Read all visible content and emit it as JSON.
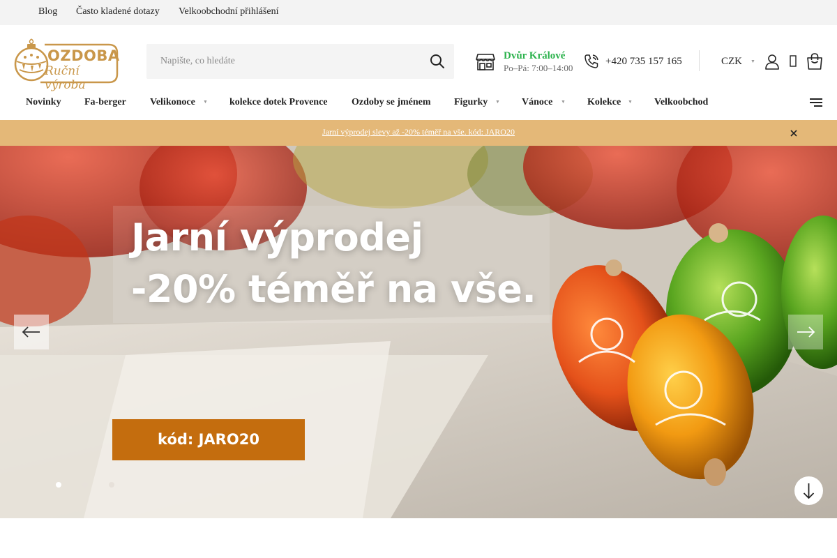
{
  "topbar": {
    "links": [
      "Blog",
      "Často kladené dotazy",
      "Velkoobchodní přihlášení"
    ]
  },
  "logo": {
    "word": "OZDOBA",
    "tagline": "Ruční výroba",
    "color": "#c9974a"
  },
  "search": {
    "placeholder": "Napište, co hledáte",
    "icon": "search-icon"
  },
  "store": {
    "city": "Dvůr Králové",
    "hours": "Po–Pá: 7:00–14:00",
    "icon": "store-icon"
  },
  "contact": {
    "phone": "+420 735 157 165",
    "icon": "phone-icon"
  },
  "currency": {
    "selected": "CZK"
  },
  "icons": [
    "user-icon",
    "heart-icon",
    "cart-icon",
    "menu-icon"
  ],
  "nav": {
    "items": [
      {
        "label": "Novinky",
        "dropdown": false
      },
      {
        "label": "Fa-berger",
        "dropdown": false
      },
      {
        "label": "Velikonoce",
        "dropdown": true
      },
      {
        "label": "kolekce dotek Provence",
        "dropdown": false
      },
      {
        "label": "Ozdoby se jménem",
        "dropdown": false
      },
      {
        "label": "Figurky",
        "dropdown": true
      },
      {
        "label": "Vánoce",
        "dropdown": true
      },
      {
        "label": "Kolekce",
        "dropdown": true
      },
      {
        "label": "Velkoobchod",
        "dropdown": false
      }
    ]
  },
  "promo": {
    "text": "Jarní výprodej slevy až -20% téměř na vše. kód: JARO20",
    "color": "#e4b878"
  },
  "hero": {
    "headline_line1": "Jarní výprodej",
    "headline_line2": "-20% téměř na vše.",
    "code_label": "kód: JARO20",
    "code_color": "#c46d0e",
    "slides_total": 3,
    "active_slide": 1
  },
  "colors": {
    "accent_green": "#2bb24c",
    "brand_gold": "#c9974a"
  }
}
